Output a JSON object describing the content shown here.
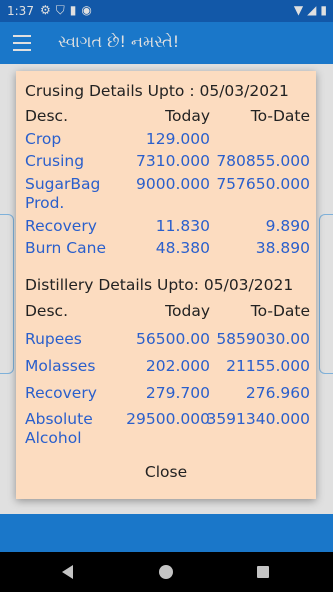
{
  "status_bar": {
    "time": "1:37",
    "left_icons": [
      "gear-icon",
      "shield-icon",
      "sim-icon",
      "circle-p-icon"
    ],
    "right_icons": [
      "wifi-icon",
      "signal-icon",
      "battery-icon"
    ]
  },
  "app_bar": {
    "title": "સ્વાગત છે! નમસ્તે!"
  },
  "dialog": {
    "crushing": {
      "title": "Crusing Details Upto : 05/03/2021",
      "col_desc": "Desc.",
      "col_today": "Today",
      "col_todate": "To-Date",
      "rows": [
        {
          "label": "Crop",
          "today": "129.000",
          "todate": ""
        },
        {
          "label": "Crusing",
          "today": "7310.000",
          "todate": "780855.000"
        },
        {
          "label": "SugarBag Prod.",
          "today": "9000.000",
          "todate": "757650.000"
        },
        {
          "label": "Recovery",
          "today": "11.830",
          "todate": "9.890"
        },
        {
          "label": "Burn Cane",
          "today": "48.380",
          "todate": "38.890"
        }
      ]
    },
    "distillery": {
      "title": "Distillery Details Upto: 05/03/2021",
      "col_desc": "Desc.",
      "col_today": "Today",
      "col_todate": "To-Date",
      "rows": [
        {
          "label": "Rupees",
          "today": "56500.00",
          "todate": "5859030.00"
        },
        {
          "label": "Molasses",
          "today": "202.000",
          "todate": "21155.000"
        },
        {
          "label": "Recovery",
          "today": "279.700",
          "todate": "276.960"
        },
        {
          "label": "Absolute Alcohol",
          "today": "29500.000",
          "todate": "3591340.000"
        }
      ]
    },
    "close_label": "Close"
  },
  "colors": {
    "status_bar": "#1565c0",
    "app_bar": "#1e88e5",
    "dialog_bg": "#fcdcc0",
    "value_text": "#2a5fcc"
  }
}
